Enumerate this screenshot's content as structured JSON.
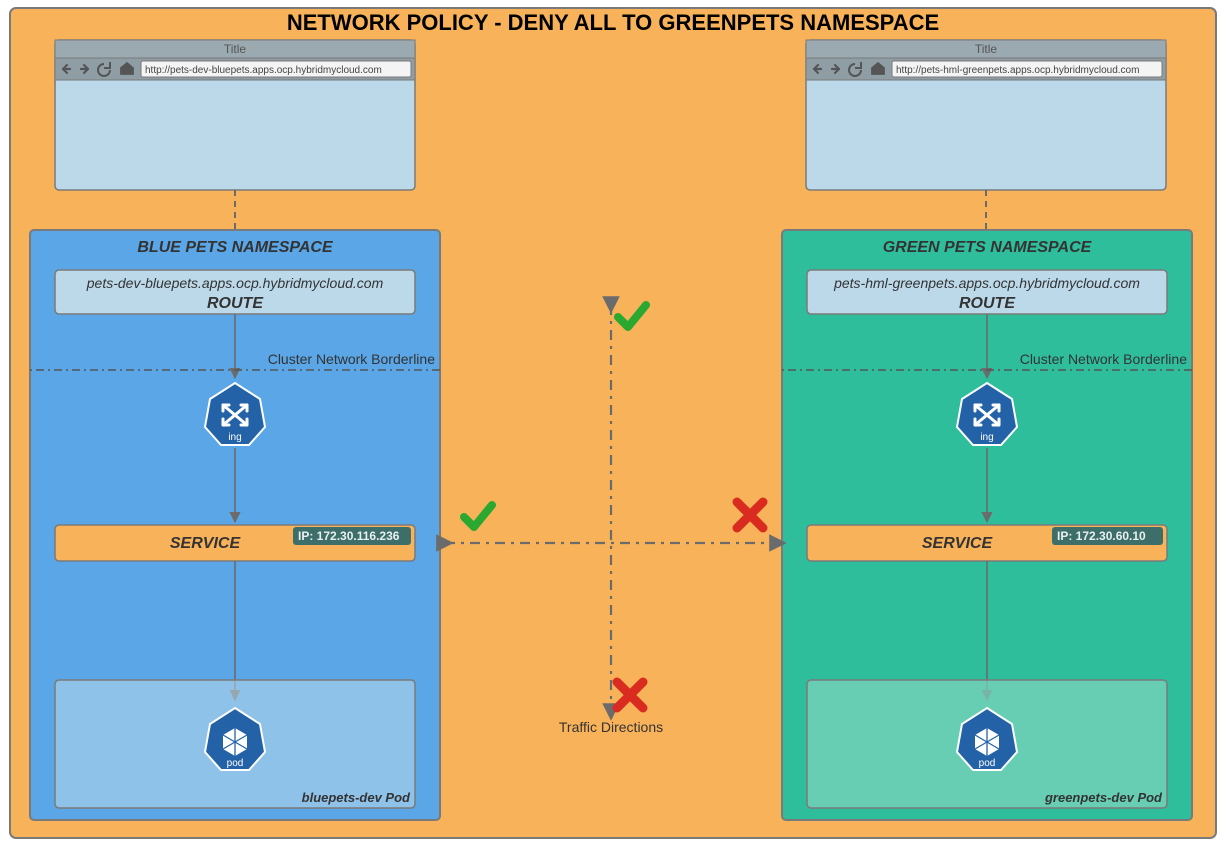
{
  "diagram": {
    "title": "NETWORK POLICY  - DENY ALL TO GREENPETS NAMESPACE",
    "traffic_label": "Traffic Directions",
    "borderline_label": "Cluster Network Borderline"
  },
  "browser": {
    "title": "Title"
  },
  "blue": {
    "browser_url": "http://pets-dev-bluepets.apps.ocp.hybridmycloud.com",
    "ns_title": "BLUE PETS NAMESPACE",
    "route_url": "pets-dev-bluepets.apps.ocp.hybridmycloud.com",
    "route_label": "ROUTE",
    "service_label": "SERVICE",
    "service_ip": "IP: 172.30.116.236",
    "pod_name": "bluepets-dev Pod",
    "ing_label": "ing",
    "pod_label": "pod"
  },
  "green": {
    "browser_url": "http://pets-hml-greenpets.apps.ocp.hybridmycloud.com",
    "ns_title": "GREEN PETS NAMESPACE",
    "route_url": "pets-hml-greenpets.apps.ocp.hybridmycloud.com",
    "route_label": "ROUTE",
    "service_label": "SERVICE",
    "service_ip": "IP: 172.30.60.10",
    "pod_name": "greenpets-dev Pod",
    "ing_label": "ing",
    "pod_label": "pod"
  },
  "colors": {
    "canvas": "#f8b35a",
    "blue_ns": "#5aa6e6",
    "green_ns": "#2fbe9c",
    "soft_blue": "#bcd9ea",
    "soft_green": "#7fd4bf",
    "k8s_blue": "#2462a8",
    "dark_teal": "#3d6e6a",
    "grey_stroke": "#7a7a7a",
    "check": "#2aa82f",
    "cross": "#d92b1f"
  }
}
